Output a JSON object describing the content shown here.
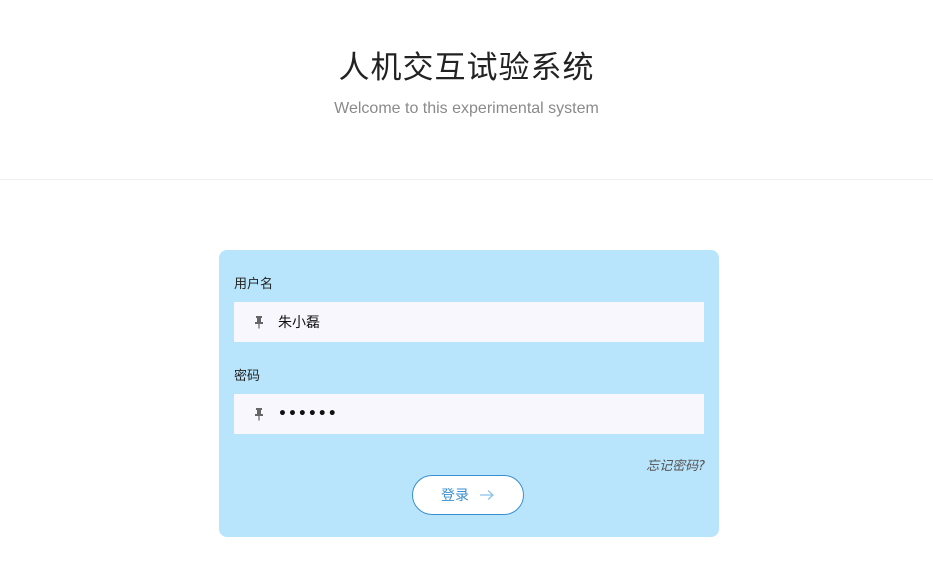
{
  "header": {
    "title": "人机交互试验系统",
    "subtitle": "Welcome to this experimental system"
  },
  "form": {
    "username_label": "用户名",
    "username_value": "朱小磊",
    "username_icon": "pin-icon",
    "password_label": "密码",
    "password_value": "••••••",
    "password_icon": "pin-icon",
    "forgot_label": "忘记密码?",
    "login_label": "登录",
    "login_icon": "arrow-right-icon"
  },
  "colors": {
    "card_bg": "#b9e5fc",
    "field_bg": "#f7f7fd",
    "accent": "#3a8fd0"
  }
}
